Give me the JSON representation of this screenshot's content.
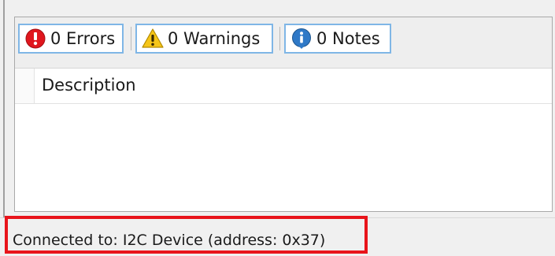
{
  "toolbar": {
    "errors_label": "0 Errors",
    "warnings_label": "0 Warnings",
    "notes_label": "0 Notes"
  },
  "table": {
    "columns": [
      "Description"
    ],
    "rows": []
  },
  "status": {
    "text": "Connected to: I2C Device (address: 0x37)"
  },
  "colors": {
    "error": "#e0161d",
    "warning": "#f5c518",
    "info": "#2f79c7",
    "toggle_border": "#7fb6e6",
    "highlight": "#e8141b"
  },
  "icons": {
    "errors": "error-icon",
    "warnings": "warning-icon",
    "notes": "info-icon"
  }
}
